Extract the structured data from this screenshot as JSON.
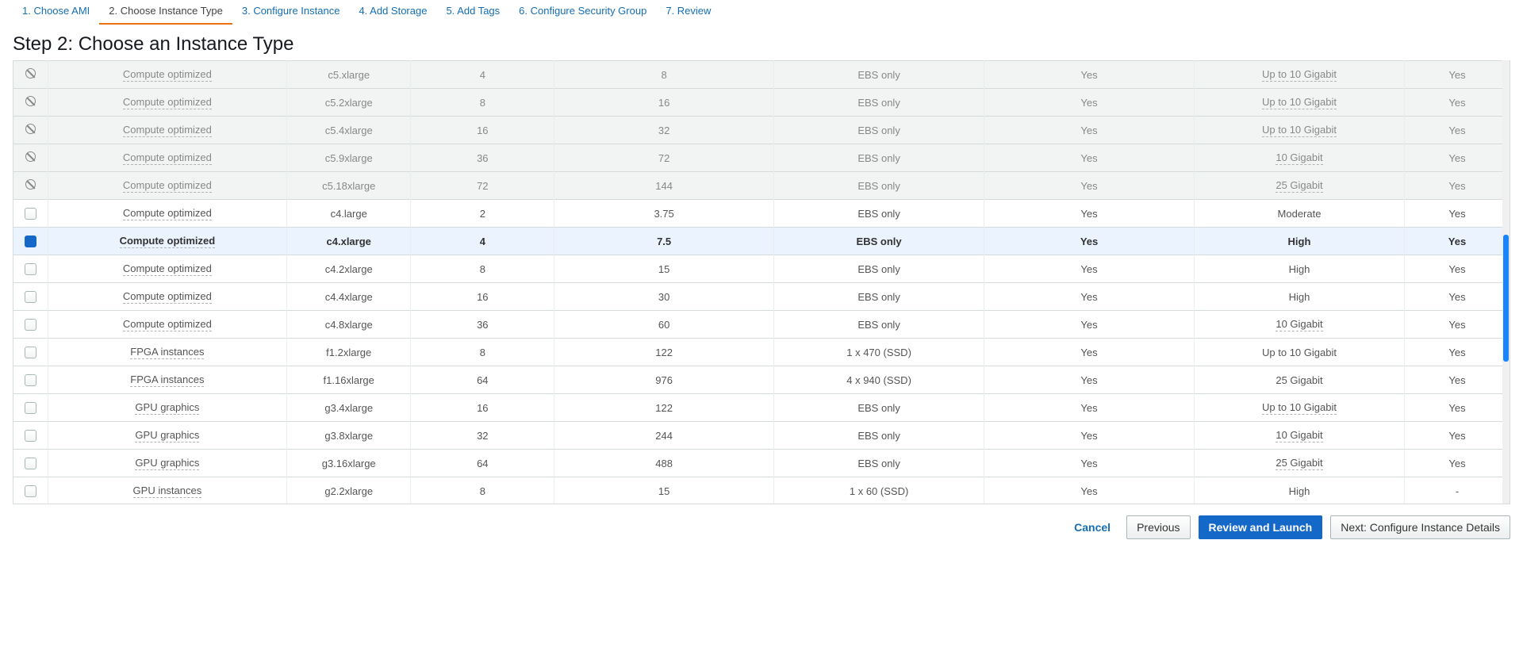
{
  "tabs": [
    {
      "label": "1. Choose AMI",
      "active": false
    },
    {
      "label": "2. Choose Instance Type",
      "active": true
    },
    {
      "label": "3. Configure Instance",
      "active": false
    },
    {
      "label": "4. Add Storage",
      "active": false
    },
    {
      "label": "5. Add Tags",
      "active": false
    },
    {
      "label": "6. Configure Security Group",
      "active": false
    },
    {
      "label": "7. Review",
      "active": false
    }
  ],
  "step_title": "Step 2: Choose an Instance Type",
  "rows": [
    {
      "disabled": true,
      "selected": false,
      "family": "Compute optimized",
      "type": "c5.xlarge",
      "vcpus": "4",
      "mem": "8",
      "storage": "EBS only",
      "ebs": "Yes",
      "net": "Up to 10 Gigabit",
      "net_dotted": true,
      "ipv6": "Yes"
    },
    {
      "disabled": true,
      "selected": false,
      "family": "Compute optimized",
      "type": "c5.2xlarge",
      "vcpus": "8",
      "mem": "16",
      "storage": "EBS only",
      "ebs": "Yes",
      "net": "Up to 10 Gigabit",
      "net_dotted": true,
      "ipv6": "Yes"
    },
    {
      "disabled": true,
      "selected": false,
      "family": "Compute optimized",
      "type": "c5.4xlarge",
      "vcpus": "16",
      "mem": "32",
      "storage": "EBS only",
      "ebs": "Yes",
      "net": "Up to 10 Gigabit",
      "net_dotted": true,
      "ipv6": "Yes"
    },
    {
      "disabled": true,
      "selected": false,
      "family": "Compute optimized",
      "type": "c5.9xlarge",
      "vcpus": "36",
      "mem": "72",
      "storage": "EBS only",
      "ebs": "Yes",
      "net": "10 Gigabit",
      "net_dotted": true,
      "ipv6": "Yes"
    },
    {
      "disabled": true,
      "selected": false,
      "family": "Compute optimized",
      "type": "c5.18xlarge",
      "vcpus": "72",
      "mem": "144",
      "storage": "EBS only",
      "ebs": "Yes",
      "net": "25 Gigabit",
      "net_dotted": true,
      "ipv6": "Yes"
    },
    {
      "disabled": false,
      "selected": false,
      "family": "Compute optimized",
      "type": "c4.large",
      "vcpus": "2",
      "mem": "3.75",
      "storage": "EBS only",
      "ebs": "Yes",
      "net": "Moderate",
      "net_dotted": false,
      "ipv6": "Yes"
    },
    {
      "disabled": false,
      "selected": true,
      "family": "Compute optimized",
      "type": "c4.xlarge",
      "vcpus": "4",
      "mem": "7.5",
      "storage": "EBS only",
      "ebs": "Yes",
      "net": "High",
      "net_dotted": false,
      "ipv6": "Yes"
    },
    {
      "disabled": false,
      "selected": false,
      "family": "Compute optimized",
      "type": "c4.2xlarge",
      "vcpus": "8",
      "mem": "15",
      "storage": "EBS only",
      "ebs": "Yes",
      "net": "High",
      "net_dotted": false,
      "ipv6": "Yes"
    },
    {
      "disabled": false,
      "selected": false,
      "family": "Compute optimized",
      "type": "c4.4xlarge",
      "vcpus": "16",
      "mem": "30",
      "storage": "EBS only",
      "ebs": "Yes",
      "net": "High",
      "net_dotted": false,
      "ipv6": "Yes"
    },
    {
      "disabled": false,
      "selected": false,
      "family": "Compute optimized",
      "type": "c4.8xlarge",
      "vcpus": "36",
      "mem": "60",
      "storage": "EBS only",
      "ebs": "Yes",
      "net": "10 Gigabit",
      "net_dotted": true,
      "ipv6": "Yes"
    },
    {
      "disabled": false,
      "selected": false,
      "family": "FPGA instances",
      "type": "f1.2xlarge",
      "vcpus": "8",
      "mem": "122",
      "storage": "1 x 470 (SSD)",
      "ebs": "Yes",
      "net": "Up to 10 Gigabit",
      "net_dotted": false,
      "ipv6": "Yes"
    },
    {
      "disabled": false,
      "selected": false,
      "family": "FPGA instances",
      "type": "f1.16xlarge",
      "vcpus": "64",
      "mem": "976",
      "storage": "4 x 940 (SSD)",
      "ebs": "Yes",
      "net": "25 Gigabit",
      "net_dotted": false,
      "ipv6": "Yes"
    },
    {
      "disabled": false,
      "selected": false,
      "family": "GPU graphics",
      "type": "g3.4xlarge",
      "vcpus": "16",
      "mem": "122",
      "storage": "EBS only",
      "ebs": "Yes",
      "net": "Up to 10 Gigabit",
      "net_dotted": true,
      "ipv6": "Yes"
    },
    {
      "disabled": false,
      "selected": false,
      "family": "GPU graphics",
      "type": "g3.8xlarge",
      "vcpus": "32",
      "mem": "244",
      "storage": "EBS only",
      "ebs": "Yes",
      "net": "10 Gigabit",
      "net_dotted": true,
      "ipv6": "Yes"
    },
    {
      "disabled": false,
      "selected": false,
      "family": "GPU graphics",
      "type": "g3.16xlarge",
      "vcpus": "64",
      "mem": "488",
      "storage": "EBS only",
      "ebs": "Yes",
      "net": "25 Gigabit",
      "net_dotted": true,
      "ipv6": "Yes"
    },
    {
      "disabled": false,
      "selected": false,
      "family": "GPU instances",
      "type": "g2.2xlarge",
      "vcpus": "8",
      "mem": "15",
      "storage": "1 x 60 (SSD)",
      "ebs": "Yes",
      "net": "High",
      "net_dotted": false,
      "ipv6": "-"
    }
  ],
  "footer": {
    "cancel": "Cancel",
    "previous": "Previous",
    "review": "Review and Launch",
    "next": "Next: Configure Instance Details"
  }
}
